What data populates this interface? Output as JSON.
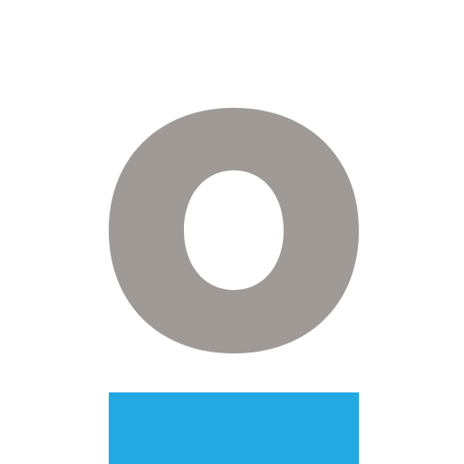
{
  "logo": {
    "icon": "letter-o-with-underline-logo",
    "colors": {
      "background": "#ffffff",
      "ring": "#a09a97",
      "bar": "#22a8e3"
    }
  }
}
